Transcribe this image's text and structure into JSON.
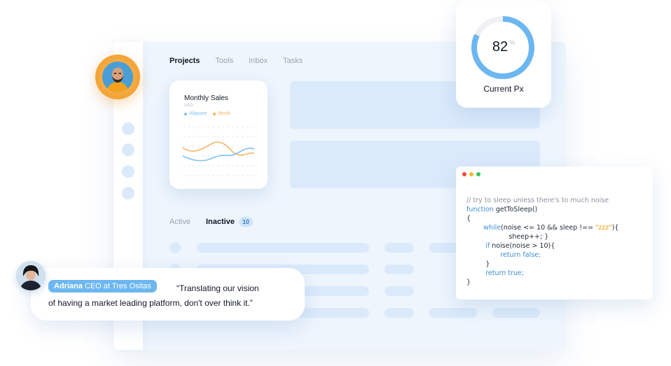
{
  "nav": {
    "tabs": [
      {
        "label": "Projects",
        "active": true
      },
      {
        "label": "Tools",
        "active": false
      },
      {
        "label": "Inbox",
        "active": false
      },
      {
        "label": "Tasks",
        "active": false
      }
    ]
  },
  "sales_card": {
    "title": "Monthly Sales",
    "subtitle": "USD",
    "legend": [
      {
        "label": "Aliquam",
        "color": "#7ec0f2"
      },
      {
        "label": "Morbi",
        "color": "#f5b462"
      }
    ]
  },
  "status_tabs": {
    "active_label": "Active",
    "inactive_label": "Inactive",
    "inactive_count": "10"
  },
  "gauge": {
    "value": "82",
    "unit": "%",
    "progress": 0.82,
    "label": "Current Px"
  },
  "code": {
    "lines": [
      "// try to sleep unless there's to much noise",
      "function getToSleep()",
      "{",
      "while(noise <= 10 && sleep !== \"zzz\"){",
      "sheep++; }",
      "if noise(noise > 10){",
      "return false;",
      "}",
      "return true;",
      "}"
    ]
  },
  "testimonial": {
    "name": "Adriana",
    "role": " CEO at Tres Ositas",
    "quote_line1": "“Translating our vision",
    "quote_line2": "of having a market leading platform, don't over think it.”"
  },
  "colors": {
    "accent": "#6cb7f1",
    "placeholder": "#dbeafb",
    "window_bg": "#eef5fd",
    "gauge_track": "#eef0f3"
  }
}
